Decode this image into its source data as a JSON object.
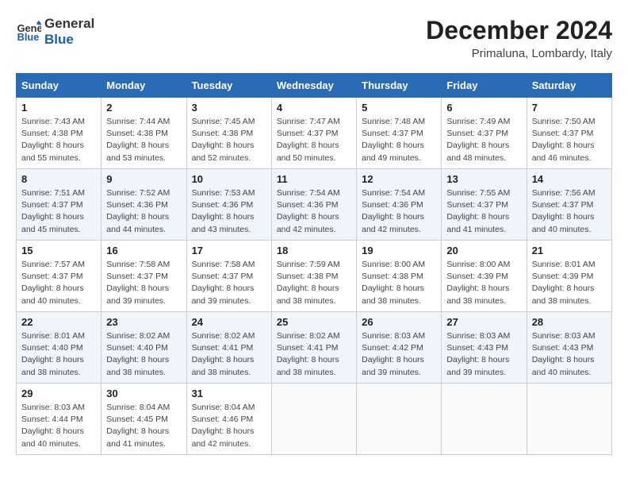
{
  "header": {
    "logo_line1": "General",
    "logo_line2": "Blue",
    "month_year": "December 2024",
    "location": "Primaluna, Lombardy, Italy"
  },
  "days_of_week": [
    "Sunday",
    "Monday",
    "Tuesday",
    "Wednesday",
    "Thursday",
    "Friday",
    "Saturday"
  ],
  "weeks": [
    [
      {
        "num": "1",
        "sunrise": "7:43 AM",
        "sunset": "4:38 PM",
        "daylight": "8 hours and 55 minutes."
      },
      {
        "num": "2",
        "sunrise": "7:44 AM",
        "sunset": "4:38 PM",
        "daylight": "8 hours and 53 minutes."
      },
      {
        "num": "3",
        "sunrise": "7:45 AM",
        "sunset": "4:38 PM",
        "daylight": "8 hours and 52 minutes."
      },
      {
        "num": "4",
        "sunrise": "7:47 AM",
        "sunset": "4:37 PM",
        "daylight": "8 hours and 50 minutes."
      },
      {
        "num": "5",
        "sunrise": "7:48 AM",
        "sunset": "4:37 PM",
        "daylight": "8 hours and 49 minutes."
      },
      {
        "num": "6",
        "sunrise": "7:49 AM",
        "sunset": "4:37 PM",
        "daylight": "8 hours and 48 minutes."
      },
      {
        "num": "7",
        "sunrise": "7:50 AM",
        "sunset": "4:37 PM",
        "daylight": "8 hours and 46 minutes."
      }
    ],
    [
      {
        "num": "8",
        "sunrise": "7:51 AM",
        "sunset": "4:37 PM",
        "daylight": "8 hours and 45 minutes."
      },
      {
        "num": "9",
        "sunrise": "7:52 AM",
        "sunset": "4:36 PM",
        "daylight": "8 hours and 44 minutes."
      },
      {
        "num": "10",
        "sunrise": "7:53 AM",
        "sunset": "4:36 PM",
        "daylight": "8 hours and 43 minutes."
      },
      {
        "num": "11",
        "sunrise": "7:54 AM",
        "sunset": "4:36 PM",
        "daylight": "8 hours and 42 minutes."
      },
      {
        "num": "12",
        "sunrise": "7:54 AM",
        "sunset": "4:36 PM",
        "daylight": "8 hours and 42 minutes."
      },
      {
        "num": "13",
        "sunrise": "7:55 AM",
        "sunset": "4:37 PM",
        "daylight": "8 hours and 41 minutes."
      },
      {
        "num": "14",
        "sunrise": "7:56 AM",
        "sunset": "4:37 PM",
        "daylight": "8 hours and 40 minutes."
      }
    ],
    [
      {
        "num": "15",
        "sunrise": "7:57 AM",
        "sunset": "4:37 PM",
        "daylight": "8 hours and 40 minutes."
      },
      {
        "num": "16",
        "sunrise": "7:58 AM",
        "sunset": "4:37 PM",
        "daylight": "8 hours and 39 minutes."
      },
      {
        "num": "17",
        "sunrise": "7:58 AM",
        "sunset": "4:37 PM",
        "daylight": "8 hours and 39 minutes."
      },
      {
        "num": "18",
        "sunrise": "7:59 AM",
        "sunset": "4:38 PM",
        "daylight": "8 hours and 38 minutes."
      },
      {
        "num": "19",
        "sunrise": "8:00 AM",
        "sunset": "4:38 PM",
        "daylight": "8 hours and 38 minutes."
      },
      {
        "num": "20",
        "sunrise": "8:00 AM",
        "sunset": "4:39 PM",
        "daylight": "8 hours and 38 minutes."
      },
      {
        "num": "21",
        "sunrise": "8:01 AM",
        "sunset": "4:39 PM",
        "daylight": "8 hours and 38 minutes."
      }
    ],
    [
      {
        "num": "22",
        "sunrise": "8:01 AM",
        "sunset": "4:40 PM",
        "daylight": "8 hours and 38 minutes."
      },
      {
        "num": "23",
        "sunrise": "8:02 AM",
        "sunset": "4:40 PM",
        "daylight": "8 hours and 38 minutes."
      },
      {
        "num": "24",
        "sunrise": "8:02 AM",
        "sunset": "4:41 PM",
        "daylight": "8 hours and 38 minutes."
      },
      {
        "num": "25",
        "sunrise": "8:02 AM",
        "sunset": "4:41 PM",
        "daylight": "8 hours and 38 minutes."
      },
      {
        "num": "26",
        "sunrise": "8:03 AM",
        "sunset": "4:42 PM",
        "daylight": "8 hours and 39 minutes."
      },
      {
        "num": "27",
        "sunrise": "8:03 AM",
        "sunset": "4:43 PM",
        "daylight": "8 hours and 39 minutes."
      },
      {
        "num": "28",
        "sunrise": "8:03 AM",
        "sunset": "4:43 PM",
        "daylight": "8 hours and 40 minutes."
      }
    ],
    [
      {
        "num": "29",
        "sunrise": "8:03 AM",
        "sunset": "4:44 PM",
        "daylight": "8 hours and 40 minutes."
      },
      {
        "num": "30",
        "sunrise": "8:04 AM",
        "sunset": "4:45 PM",
        "daylight": "8 hours and 41 minutes."
      },
      {
        "num": "31",
        "sunrise": "8:04 AM",
        "sunset": "4:46 PM",
        "daylight": "8 hours and 42 minutes."
      },
      null,
      null,
      null,
      null
    ]
  ]
}
